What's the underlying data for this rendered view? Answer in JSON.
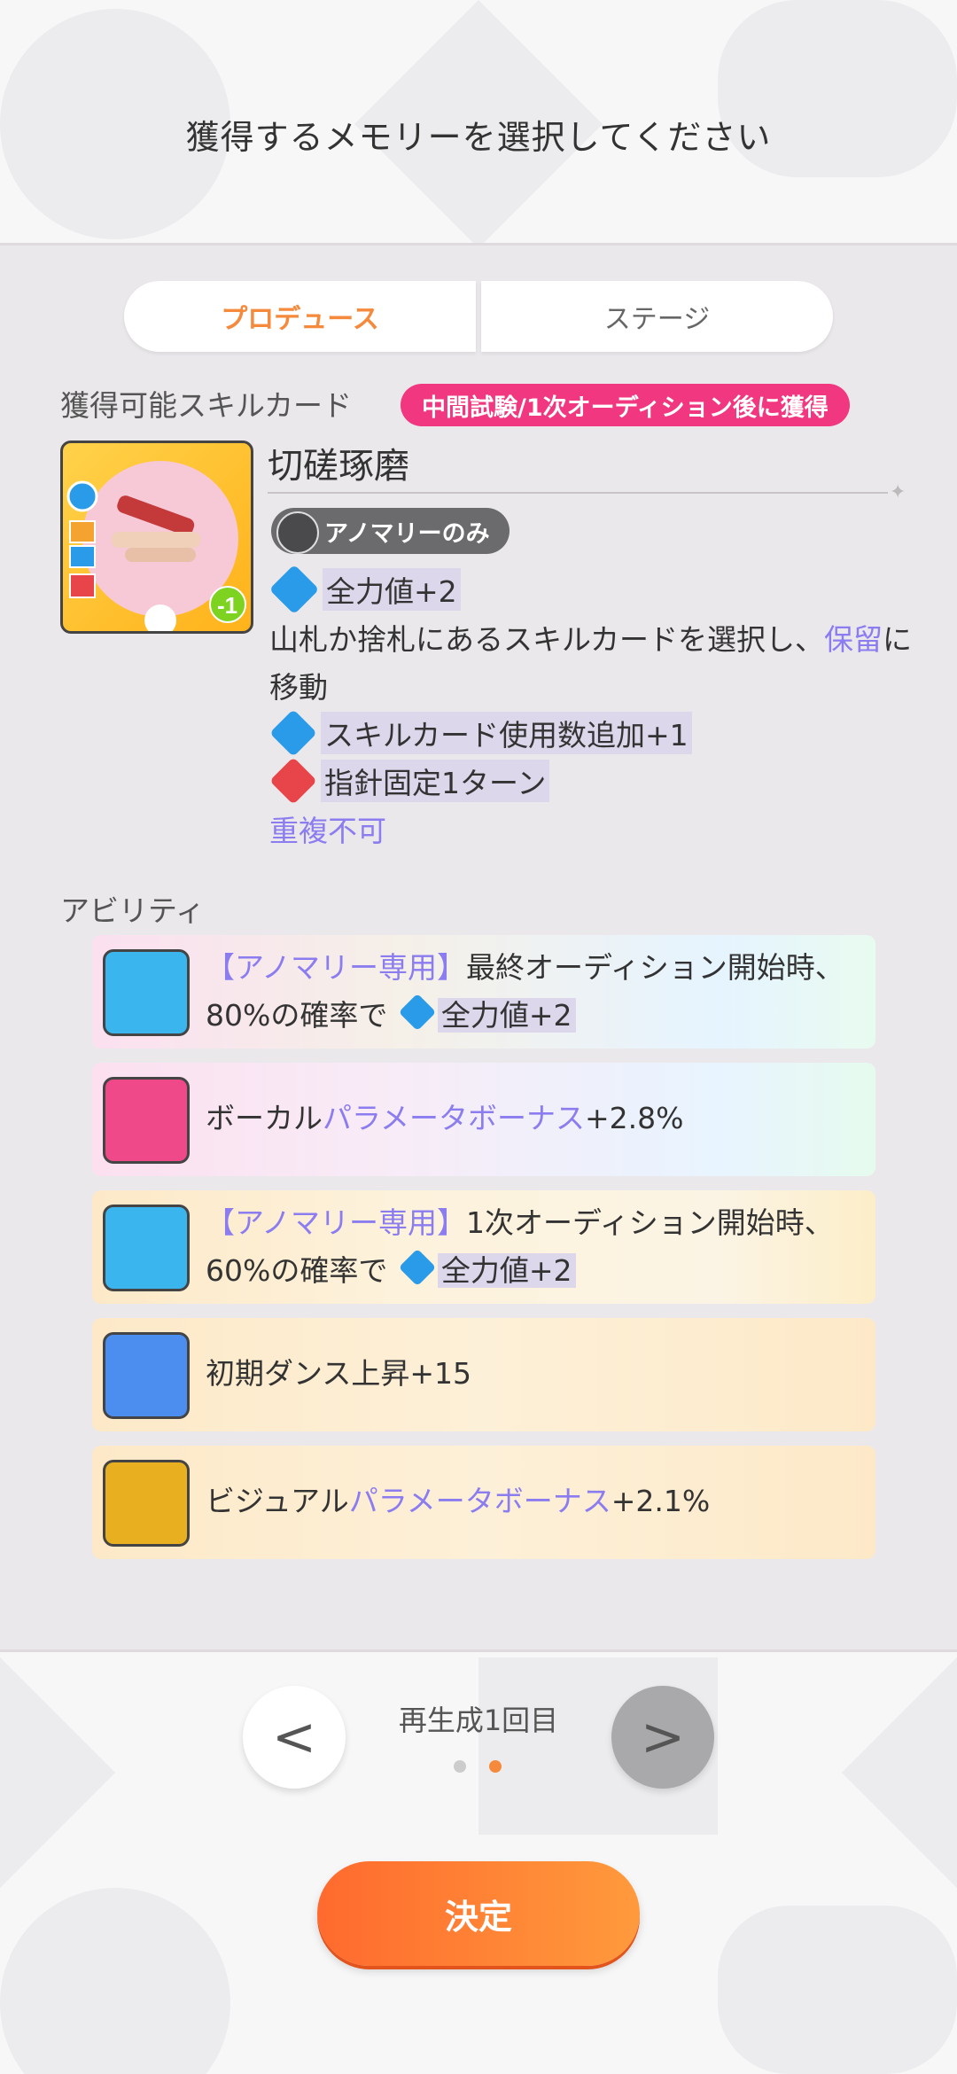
{
  "header": {
    "title": "獲得するメモリーを選択してください"
  },
  "tabs": [
    {
      "label": "プロデュース"
    },
    {
      "label": "ステージ"
    }
  ],
  "skill_section": {
    "title": "獲得可能スキルカード",
    "badge": "中間試験/1次オーディション後に獲得",
    "card": {
      "name": "切磋琢磨",
      "tag": "アノマリーのみ",
      "cost_badge": "-1",
      "effect_power": "全力値+2",
      "desc_prefix": "山札か捨札にあるスキルカードを選択し、",
      "desc_link": "保留",
      "desc_suffix": "に移動",
      "effect_skill_use": "スキルカード使用数追加+1",
      "effect_fixed": "指針固定1ターン",
      "no_duplicate": "重複不可"
    }
  },
  "ability_section": {
    "title": "アビリティ",
    "items": [
      {
        "icon": "power-icon",
        "prefix": "【アノマリー専用】",
        "text1": "最終オーディション開始時、80%の確率で",
        "effect": "全力値+2"
      },
      {
        "icon": "microphone-icon",
        "text_plain": "ボーカル",
        "link": "パラメータボーナス",
        "suffix": "+2.8%"
      },
      {
        "icon": "power-icon",
        "prefix": "【アノマリー専用】",
        "text1": "1次オーディション開始時、60%の確率で",
        "effect": "全力値+2"
      },
      {
        "icon": "dance-icon",
        "text_plain": "初期ダンス上昇+15"
      },
      {
        "icon": "visual-icon",
        "text_plain": "ビジュアル",
        "link": "パラメータボーナス",
        "suffix": "+2.1%"
      }
    ]
  },
  "pager": {
    "label": "再生成1回目",
    "prev": "<",
    "next": ">"
  },
  "confirm_label": "決定",
  "colors": {
    "accent": "#f58a3c",
    "pink": "#f0377f",
    "purple": "#8b7df0"
  }
}
